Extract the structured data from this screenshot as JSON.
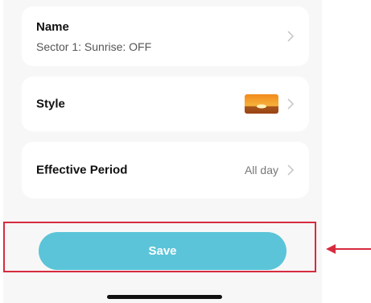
{
  "settings": {
    "name": {
      "label": "Name",
      "value": "Sector 1: Sunrise: OFF"
    },
    "style": {
      "label": "Style",
      "thumbnail_icon": "sunrise-thumbnail"
    },
    "effective_period": {
      "label": "Effective Period",
      "value": "All day"
    }
  },
  "actions": {
    "save_label": "Save"
  },
  "colors": {
    "save_button": "#5bc4d8",
    "highlight": "#d62b3f"
  }
}
